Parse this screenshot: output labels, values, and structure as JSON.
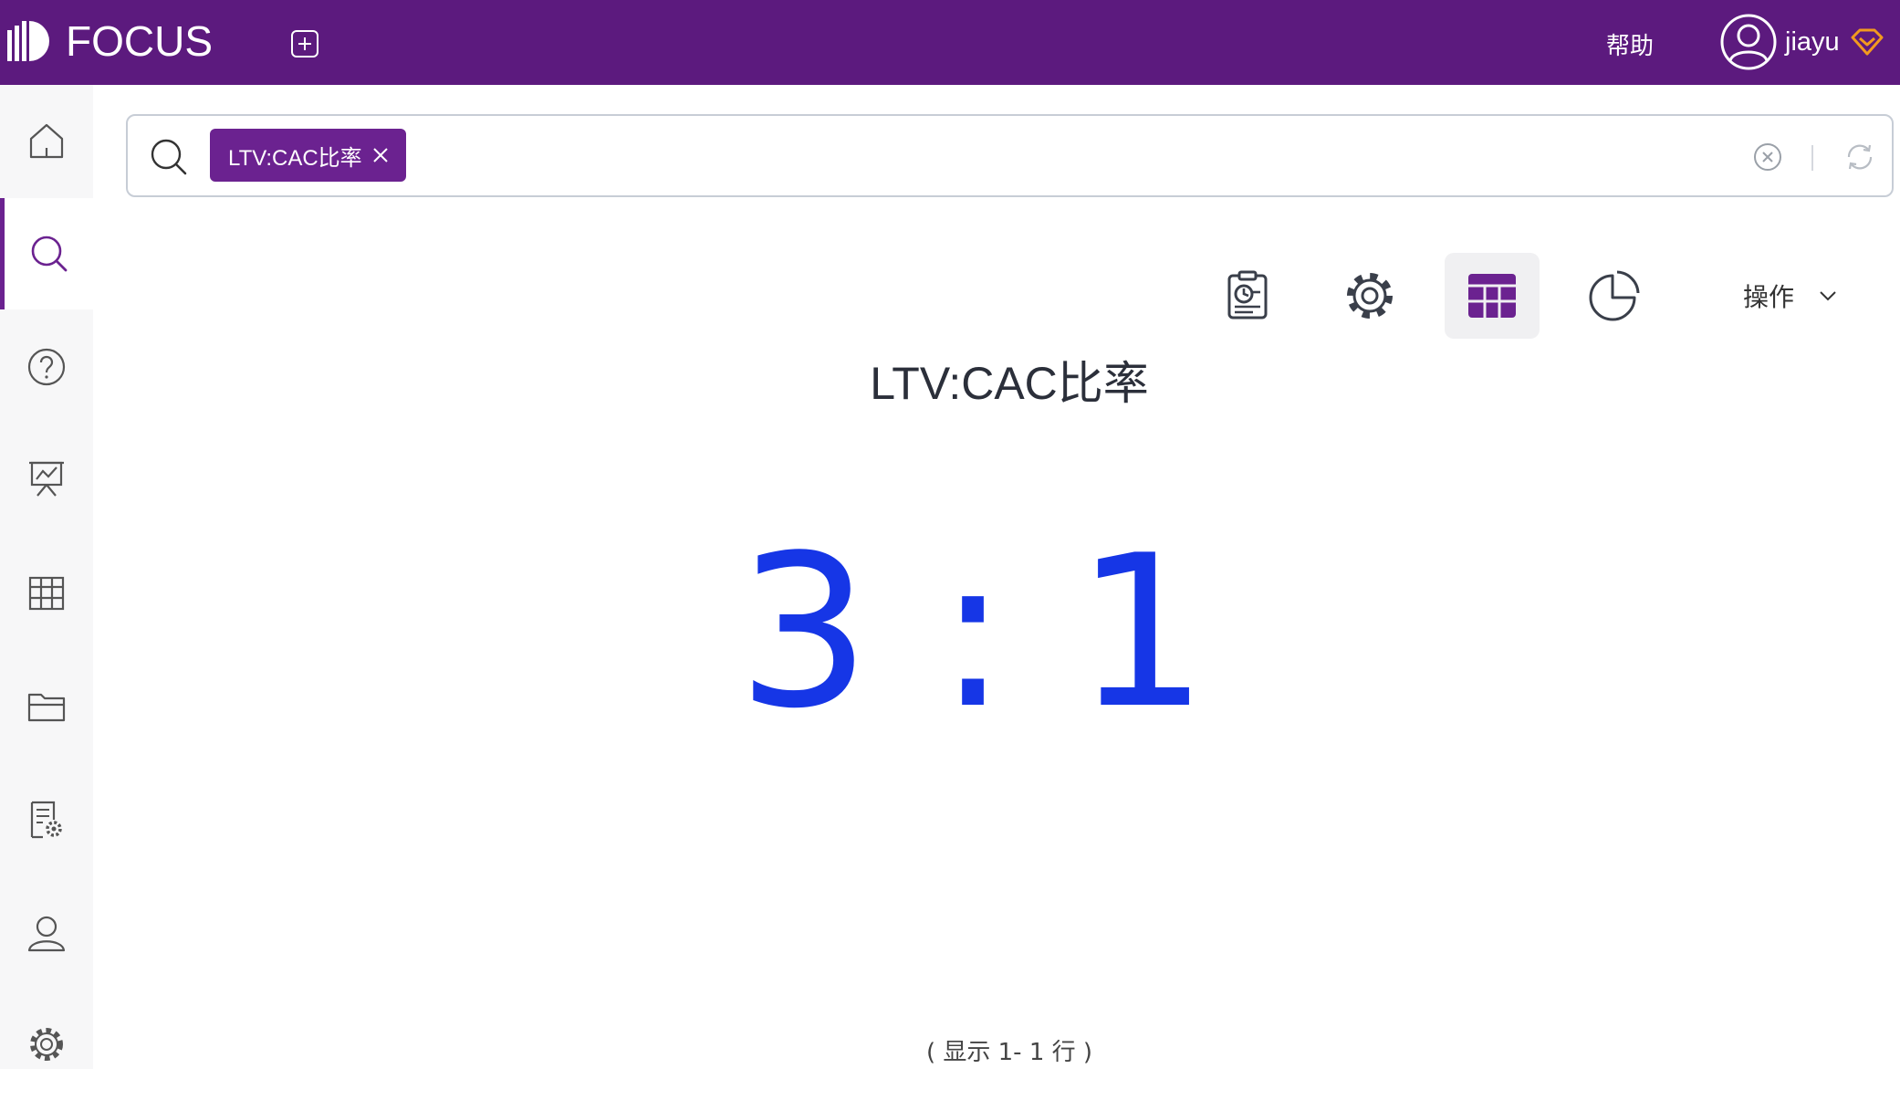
{
  "header": {
    "logo_text": "FOCUS",
    "help_label": "帮助",
    "username": "jiayu",
    "bg_color": "#5c1a7e",
    "icons": [
      "logo-icon",
      "add-tab-icon",
      "user-avatar-icon",
      "vip-diamond-icon"
    ]
  },
  "sidebar": {
    "items": [
      {
        "name": "home",
        "icon": "home-icon",
        "active": false
      },
      {
        "name": "search",
        "icon": "search-icon",
        "active": true
      },
      {
        "name": "help",
        "icon": "question-icon",
        "active": false
      },
      {
        "name": "dashboard",
        "icon": "presentation-chart-icon",
        "active": false
      },
      {
        "name": "table",
        "icon": "table-icon",
        "active": false
      },
      {
        "name": "folder",
        "icon": "folder-icon",
        "active": false
      },
      {
        "name": "report-settings",
        "icon": "document-gear-icon",
        "active": false
      },
      {
        "name": "user",
        "icon": "user-icon",
        "active": false
      },
      {
        "name": "settings",
        "icon": "gear-icon",
        "active": false
      }
    ],
    "accent_color": "#6b2290"
  },
  "search": {
    "token": "LTV:CAC比率",
    "token_color": "#6b2290"
  },
  "toolbar": {
    "buttons": [
      {
        "name": "clipboard-chart",
        "icon": "clipboard-chart-icon",
        "selected": false
      },
      {
        "name": "settings",
        "icon": "gear-icon",
        "selected": false
      },
      {
        "name": "table-view",
        "icon": "table-icon",
        "selected": true
      },
      {
        "name": "pie-chart",
        "icon": "pie-chart-icon",
        "selected": false
      }
    ],
    "ops_label": "操作"
  },
  "result": {
    "title": "LTV:CAC比率",
    "value": "3 : 1",
    "value_color": "#1636e6",
    "footer": "( 显示 1- 1 行 )"
  }
}
